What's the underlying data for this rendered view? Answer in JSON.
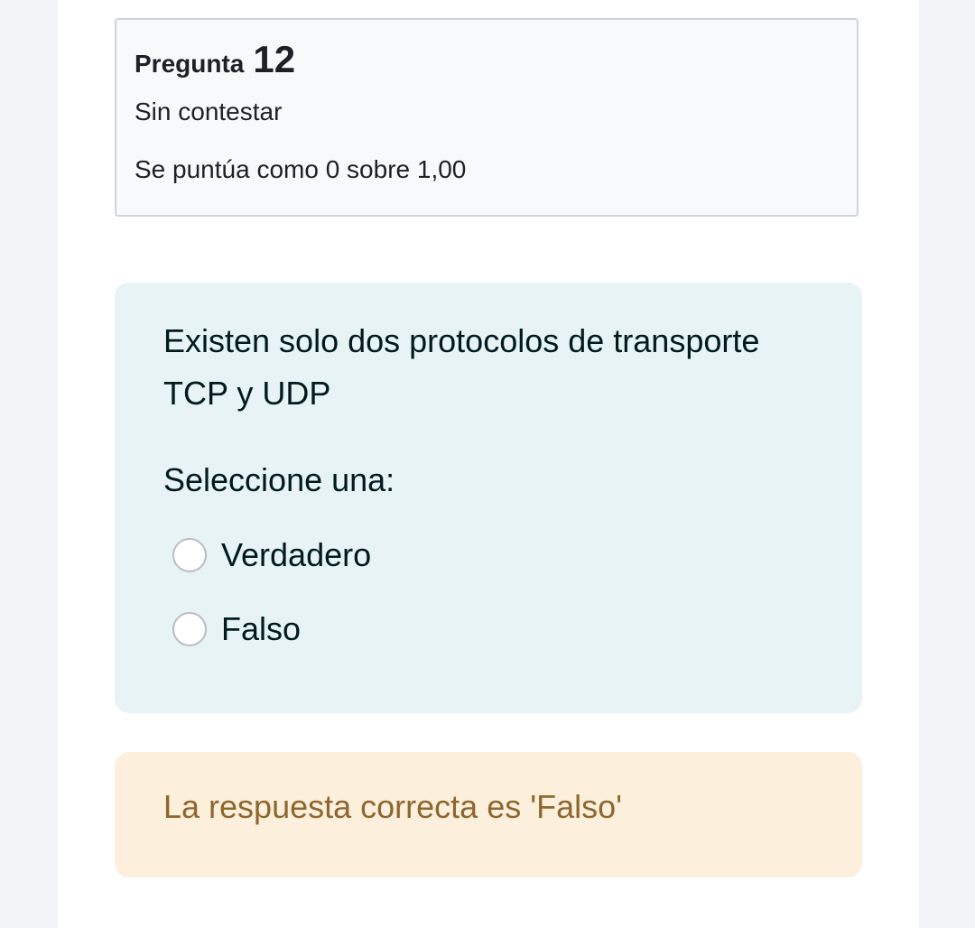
{
  "question_info": {
    "label": "Pregunta",
    "number": "12",
    "state": "Sin contestar",
    "grade": "Se puntúa como 0 sobre 1,00"
  },
  "formulation": {
    "text_line1": "Existen solo dos protocolos de transporte",
    "text_line2": "TCP y UDP",
    "prompt": "Seleccione una:",
    "options": [
      {
        "label": "Verdadero",
        "selected": false
      },
      {
        "label": "Falso",
        "selected": false
      }
    ]
  },
  "feedback": {
    "right_answer": "La respuesta correcta es 'Falso'"
  },
  "colors": {
    "page_background": "#f1f3f6",
    "info_background": "#f8f9fa",
    "formulation_background": "#e7f3f5",
    "feedback_background": "#fcefdc",
    "feedback_text": "#8e662e"
  }
}
